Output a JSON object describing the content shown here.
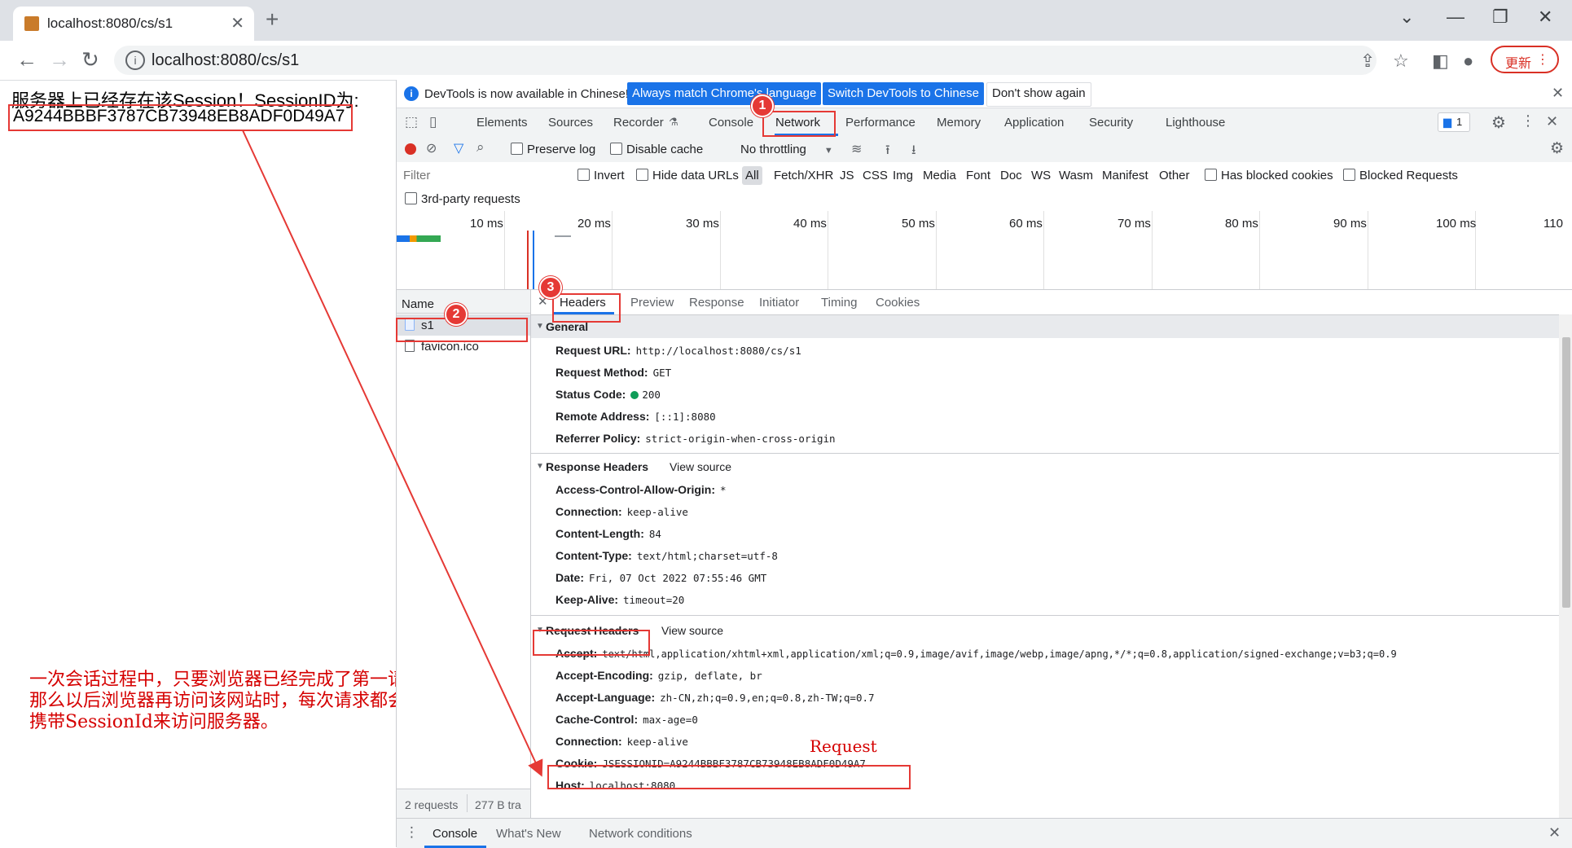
{
  "browser": {
    "tab_title": "localhost:8080/cs/s1",
    "url": "localhost:8080/cs/s1",
    "update_label": "更新"
  },
  "page": {
    "line1": "服务器上已经存在该Session！SessionID为:",
    "session_id": "A9244BBBF3787CB73948EB8ADF0D49A7"
  },
  "devtools": {
    "infobar": {
      "message": "DevTools is now available in Chinese!",
      "btn_match": "Always match Chrome's language",
      "btn_switch": "Switch DevTools to Chinese",
      "btn_dont": "Don't show again"
    },
    "tabs": [
      "Elements",
      "Sources",
      "Recorder",
      "Console",
      "Network",
      "Performance",
      "Memory",
      "Application",
      "Security",
      "Lighthouse"
    ],
    "issues_count": "1",
    "controls": {
      "preserve_log": "Preserve log",
      "disable_cache": "Disable cache",
      "throttling": "No throttling"
    },
    "filter": {
      "placeholder": "Filter",
      "invert": "Invert",
      "hide_data_urls": "Hide data URLs",
      "types": [
        "All",
        "Fetch/XHR",
        "JS",
        "CSS",
        "Img",
        "Media",
        "Font",
        "Doc",
        "WS",
        "Wasm",
        "Manifest",
        "Other"
      ],
      "has_blocked_cookies": "Has blocked cookies",
      "blocked_requests": "Blocked Requests",
      "third_party": "3rd-party requests"
    },
    "timeline_ticks": [
      "10 ms",
      "20 ms",
      "30 ms",
      "40 ms",
      "50 ms",
      "60 ms",
      "70 ms",
      "80 ms",
      "90 ms",
      "100 ms",
      "110"
    ],
    "requests": {
      "header": "Name",
      "items": [
        "s1",
        "favicon.ico"
      ],
      "footer_count": "2 requests",
      "footer_transfer": "277 B tra"
    },
    "detail_tabs": [
      "Headers",
      "Preview",
      "Response",
      "Initiator",
      "Timing",
      "Cookies"
    ],
    "general": {
      "title": "General",
      "rows": [
        {
          "k": "Request URL:",
          "v": "http://localhost:8080/cs/s1"
        },
        {
          "k": "Request Method:",
          "v": "GET"
        },
        {
          "k": "Status Code:",
          "v": "200"
        },
        {
          "k": "Remote Address:",
          "v": "[::1]:8080"
        },
        {
          "k": "Referrer Policy:",
          "v": "strict-origin-when-cross-origin"
        }
      ]
    },
    "response_headers": {
      "title": "Response Headers",
      "view_source": "View source",
      "rows": [
        {
          "k": "Access-Control-Allow-Origin:",
          "v": "*"
        },
        {
          "k": "Connection:",
          "v": "keep-alive"
        },
        {
          "k": "Content-Length:",
          "v": "84"
        },
        {
          "k": "Content-Type:",
          "v": "text/html;charset=utf-8"
        },
        {
          "k": "Date:",
          "v": "Fri, 07 Oct 2022 07:55:46 GMT"
        },
        {
          "k": "Keep-Alive:",
          "v": "timeout=20"
        }
      ]
    },
    "request_headers": {
      "title": "Request Headers",
      "view_source": "View source",
      "rows": [
        {
          "k": "Accept:",
          "v": "text/html,application/xhtml+xml,application/xml;q=0.9,image/avif,image/webp,image/apng,*/*;q=0.8,application/signed-exchange;v=b3;q=0.9"
        },
        {
          "k": "Accept-Encoding:",
          "v": "gzip, deflate, br"
        },
        {
          "k": "Accept-Language:",
          "v": "zh-CN,zh;q=0.9,en;q=0.8,zh-TW;q=0.7"
        },
        {
          "k": "Cache-Control:",
          "v": "max-age=0"
        },
        {
          "k": "Connection:",
          "v": "keep-alive"
        },
        {
          "k": "Cookie:",
          "v": "JSESSIONID=A9244BBBF3787CB73948EB8ADF0D49A7"
        },
        {
          "k": "Host:",
          "v": "localhost:8080"
        }
      ]
    },
    "drawer": [
      "Console",
      "What's New",
      "Network conditions"
    ]
  },
  "annotations": {
    "badges": [
      "1",
      "2",
      "3"
    ],
    "note": [
      "一次会话过程中，只要浏览器已经完成了第一请求，",
      "那么以后浏览器再访问该网站时，每次请求都会自动",
      "携带SessionId来访问服务器。"
    ],
    "request_label": "Request"
  },
  "colors": {
    "annotation_red": "#e53935",
    "devtools_blue": "#1a73e8",
    "status_green": "#0f9d58"
  }
}
